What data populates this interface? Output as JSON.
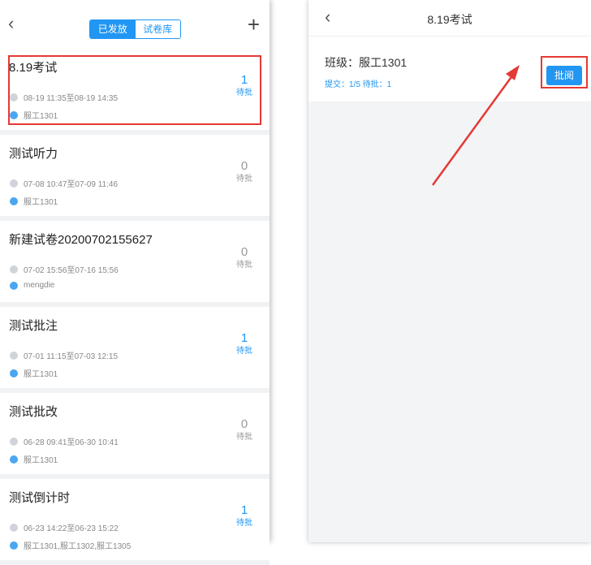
{
  "left": {
    "tabs": {
      "active": "已发放",
      "inactive": "试卷库"
    },
    "back_glyph": "‹",
    "add_glyph": "+",
    "items": [
      {
        "title": "8.19考试",
        "time": "08-19 11:35至08-19 14:35",
        "group": "服工1301",
        "count": "1",
        "status": "待批"
      },
      {
        "title": "测试听力",
        "time": "07-08 10:47至07-09 11:46",
        "group": "服工1301",
        "count": "0",
        "status": "待批"
      },
      {
        "title": "新建试卷20200702155627",
        "time": "07-02 15:56至07-16 15:56",
        "group": "mengdie",
        "count": "0",
        "status": "待批"
      },
      {
        "title": "测试批注",
        "time": "07-01 11:15至07-03 12:15",
        "group": "服工1301",
        "count": "1",
        "status": "待批"
      },
      {
        "title": "测试批改",
        "time": "06-28 09:41至06-30 10:41",
        "group": "服工1301",
        "count": "0",
        "status": "待批"
      },
      {
        "title": "测试倒计时",
        "time": "06-23 14:22至06-23 15:22",
        "group": "服工1301,服工1302,服工1305",
        "count": "1",
        "status": "待批"
      }
    ]
  },
  "right": {
    "title": "8.19考试",
    "class_label": "班级：服工1301",
    "submit_info": "提交：1/5   待批：1",
    "review_button": "批阅"
  },
  "colors": {
    "accent": "#2196f3",
    "highlight": "#e53935"
  }
}
